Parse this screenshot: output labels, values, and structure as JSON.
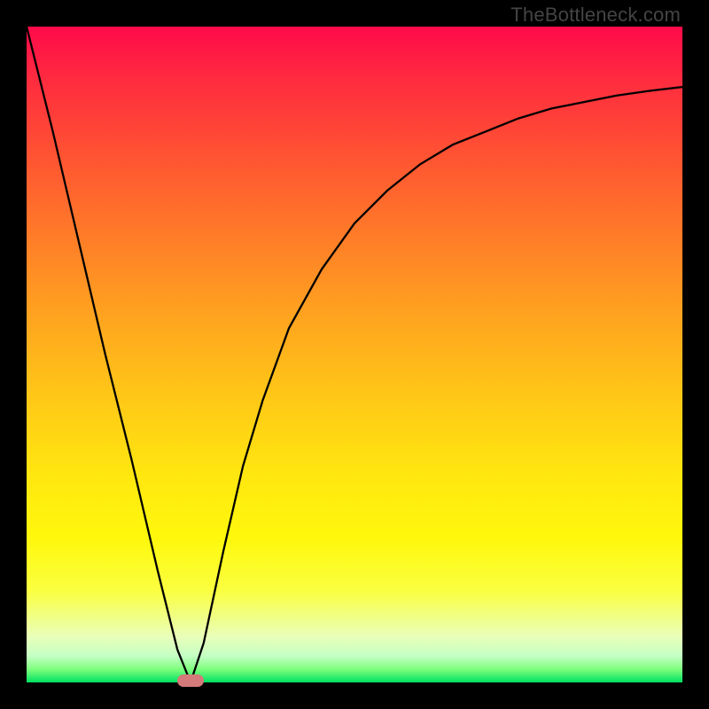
{
  "watermark": "TheBottleneck.com",
  "colors": {
    "frame": "#000000",
    "curve": "#000000",
    "marker": "#d47a7a"
  },
  "chart_data": {
    "type": "line",
    "title": "",
    "xlabel": "",
    "ylabel": "",
    "xlim": [
      0,
      100
    ],
    "ylim": [
      0,
      100
    ],
    "grid": false,
    "series": [
      {
        "name": "curve",
        "x": [
          0,
          4,
          8,
          12,
          16,
          20,
          23,
          25,
          27,
          30,
          33,
          36,
          40,
          45,
          50,
          55,
          60,
          65,
          70,
          75,
          80,
          85,
          90,
          95,
          100
        ],
        "y": [
          100,
          84,
          67,
          50,
          34,
          17,
          5,
          0,
          6,
          20,
          33,
          43,
          54,
          63,
          70,
          75,
          79,
          82,
          84,
          86,
          87.5,
          88.5,
          89.5,
          90.2,
          90.8
        ]
      }
    ],
    "marker": {
      "x": 25,
      "y": 0
    },
    "background_gradient": {
      "top": "#ff0a4a",
      "mid": "#ffe610",
      "bottom": "#00e060"
    }
  }
}
